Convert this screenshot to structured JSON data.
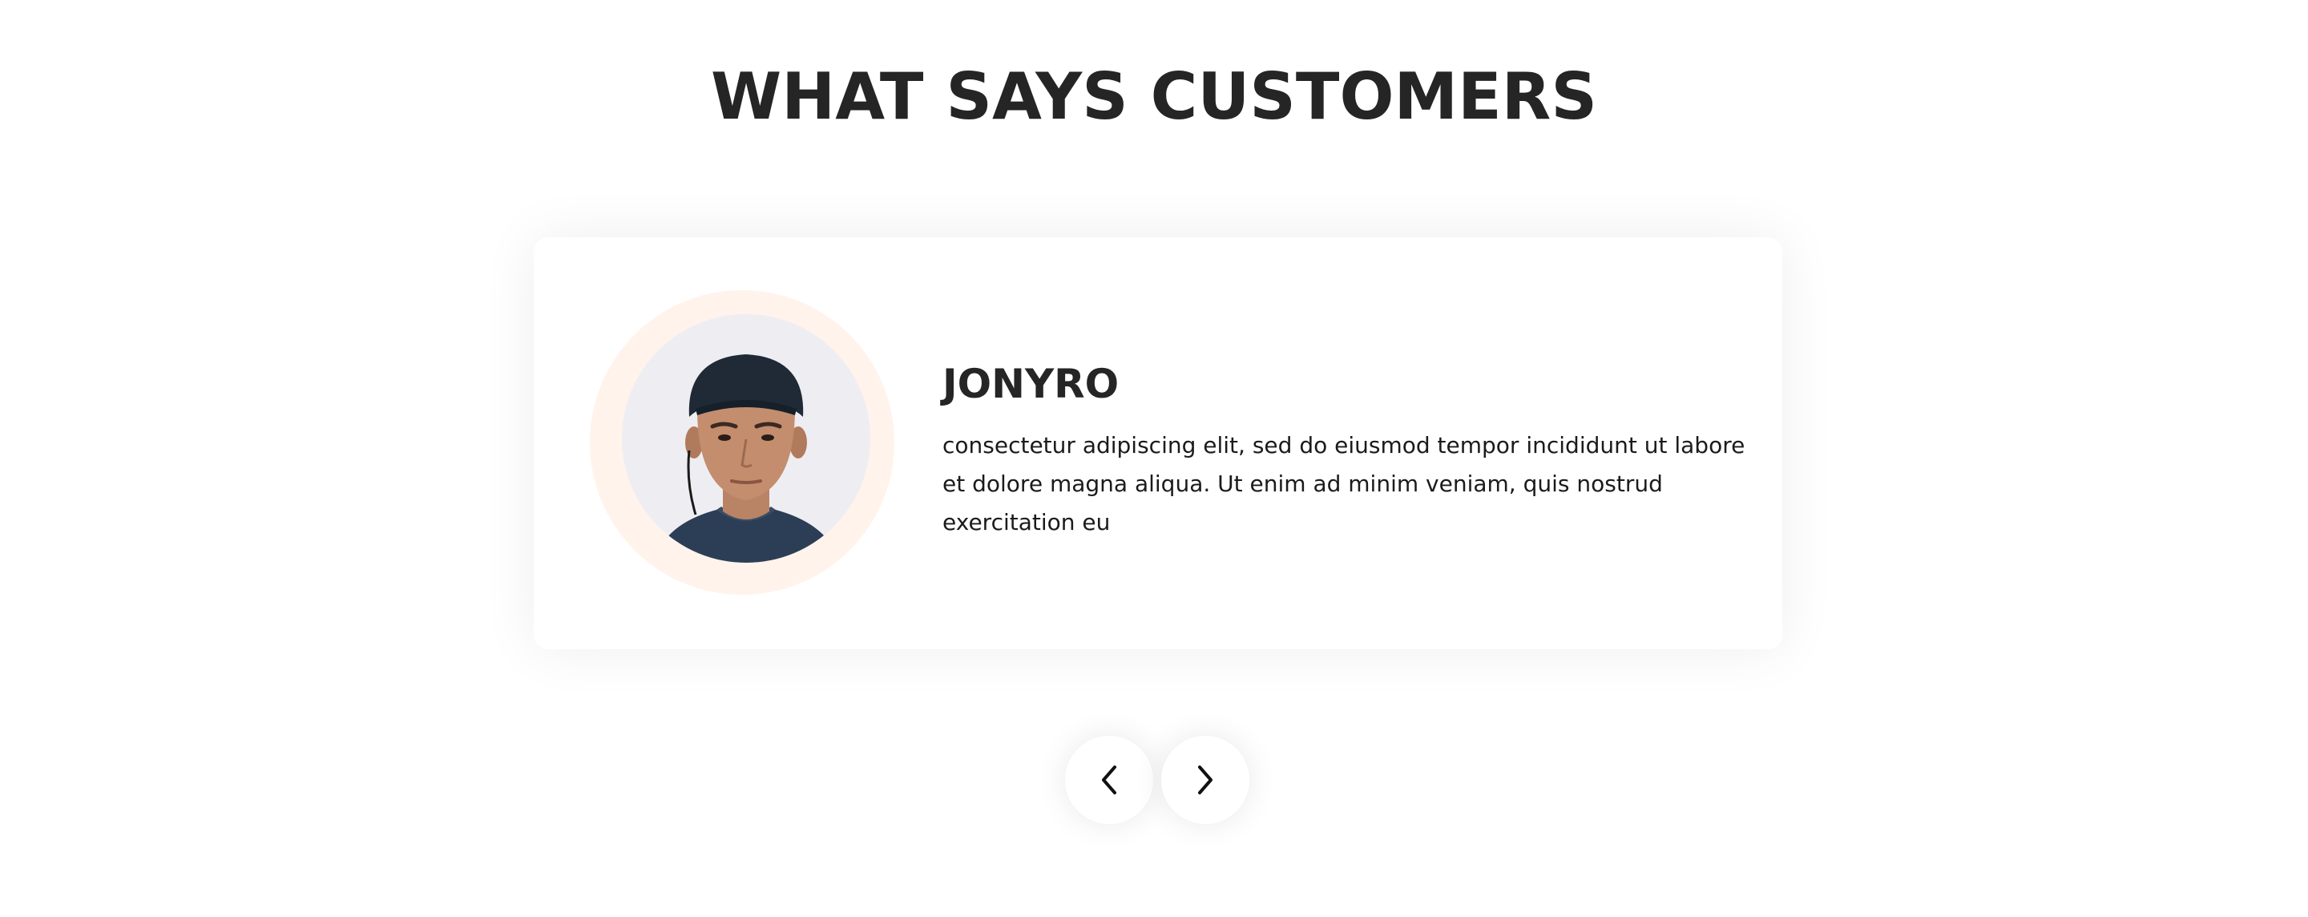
{
  "section": {
    "title": "WHAT SAYS CUSTOMERS"
  },
  "testimonial": {
    "name": "JONYRO",
    "text": "consectetur adipiscing elit, sed do eiusmod tempor incididunt ut labore et dolore magna aliqua. Ut enim ad minim veniam, quis nostrud exercitation eu",
    "avatar_icon": "customer-photo"
  },
  "navigation": {
    "prev_icon": "chevron-left-icon",
    "next_icon": "chevron-right-icon"
  },
  "colors": {
    "heading": "#252525",
    "body_text": "#1b1b1b",
    "avatar_ring": "#fff3ec",
    "card_background": "#ffffff"
  }
}
